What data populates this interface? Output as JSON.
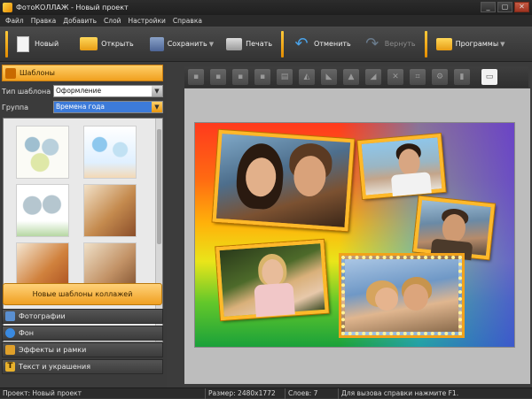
{
  "window": {
    "title": "ФотоКОЛЛАЖ - Новый проект",
    "buttons": [
      "_",
      "▢",
      "✕"
    ]
  },
  "menu": [
    "Файл",
    "Правка",
    "Добавить",
    "Слой",
    "Настройки",
    "Справка"
  ],
  "toolbar": {
    "new": "Новый",
    "open": "Открыть",
    "save": "Сохранить",
    "print": "Печать",
    "undo": "Отменить",
    "redo": "Вернуть",
    "programs": "Программы"
  },
  "left_panel": {
    "templates_header": "Шаблоны",
    "template_type_label": "Тип шаблона",
    "template_type_value": "Оформление",
    "group_label": "Группа",
    "group_value": "Времена года",
    "new_templates_button": "Новые шаблоны коллажей",
    "sections": [
      "Фотографии",
      "Фон",
      "Эффекты и рамки",
      "Текст и украшения"
    ]
  },
  "status": {
    "project": "Проект: Новый проект",
    "size": "Размер: 2480x1772",
    "layers": "Слоев: 7",
    "help": "Для вызова справки нажмите F1."
  },
  "colors": {
    "accent": "#f0a01e",
    "canvas_gradient_start": "#ff3a1d",
    "canvas_gradient_end": "#4646f0"
  }
}
